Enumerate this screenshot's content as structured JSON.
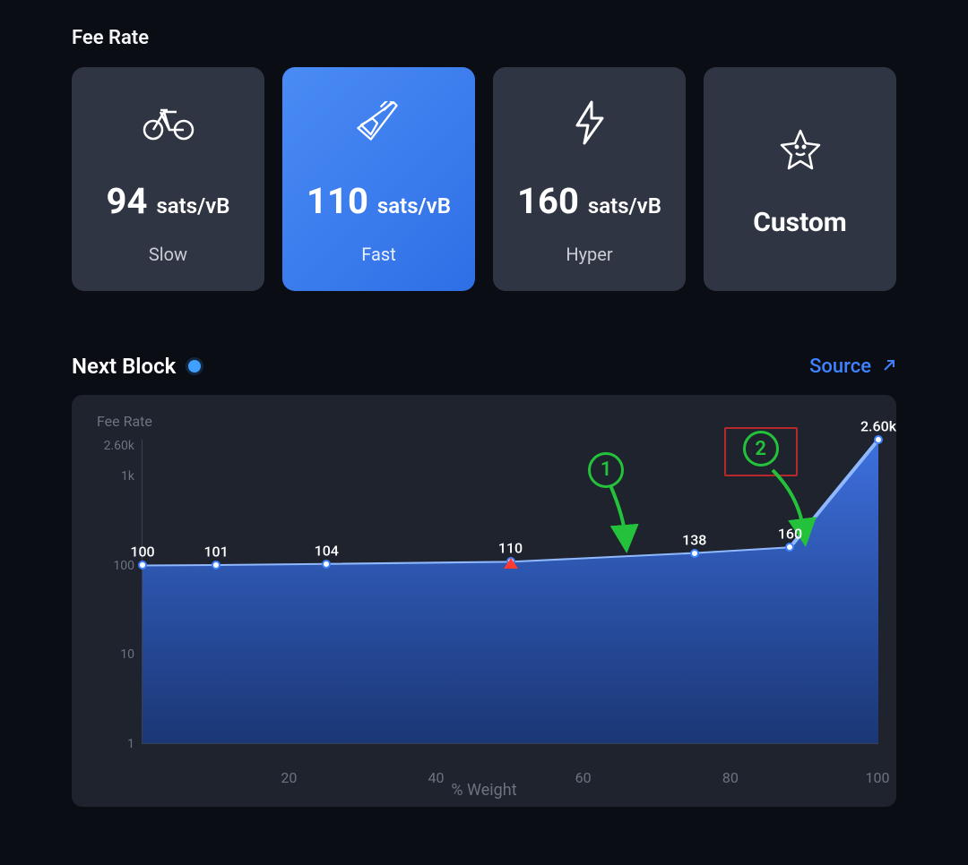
{
  "fee_rate": {
    "title": "Fee Rate",
    "unit": "sats/vB",
    "cards": [
      {
        "value": "94",
        "name": "Slow",
        "icon": "bicycle"
      },
      {
        "value": "110",
        "name": "Fast",
        "icon": "airplane",
        "selected": true
      },
      {
        "value": "160",
        "name": "Hyper",
        "icon": "bolt"
      },
      {
        "custom": true,
        "label": "Custom",
        "icon": "star"
      }
    ]
  },
  "next_block": {
    "title": "Next Block",
    "source_label": "Source"
  },
  "chart_data": {
    "type": "area",
    "title": "Fee Rate",
    "xlabel": "% Weight",
    "ylabel": "Fee Rate",
    "yscale": "log",
    "ylim": [
      1,
      2600
    ],
    "xlim": [
      0,
      100
    ],
    "y_ticks": [
      "2.60k",
      "1k",
      "100",
      "10",
      "1"
    ],
    "x_ticks": [
      "20",
      "40",
      "60",
      "80",
      "100"
    ],
    "x": [
      0,
      10,
      25,
      50,
      75,
      88,
      100
    ],
    "values": [
      100,
      101,
      104,
      110,
      138,
      160,
      2600
    ],
    "labels": [
      "100",
      "101",
      "104",
      "110",
      "138",
      "160",
      "2.60k"
    ],
    "marker_x": 50,
    "annotations": [
      {
        "id": "1",
        "target_x": 63
      },
      {
        "id": "2",
        "target_x": 88
      }
    ]
  }
}
